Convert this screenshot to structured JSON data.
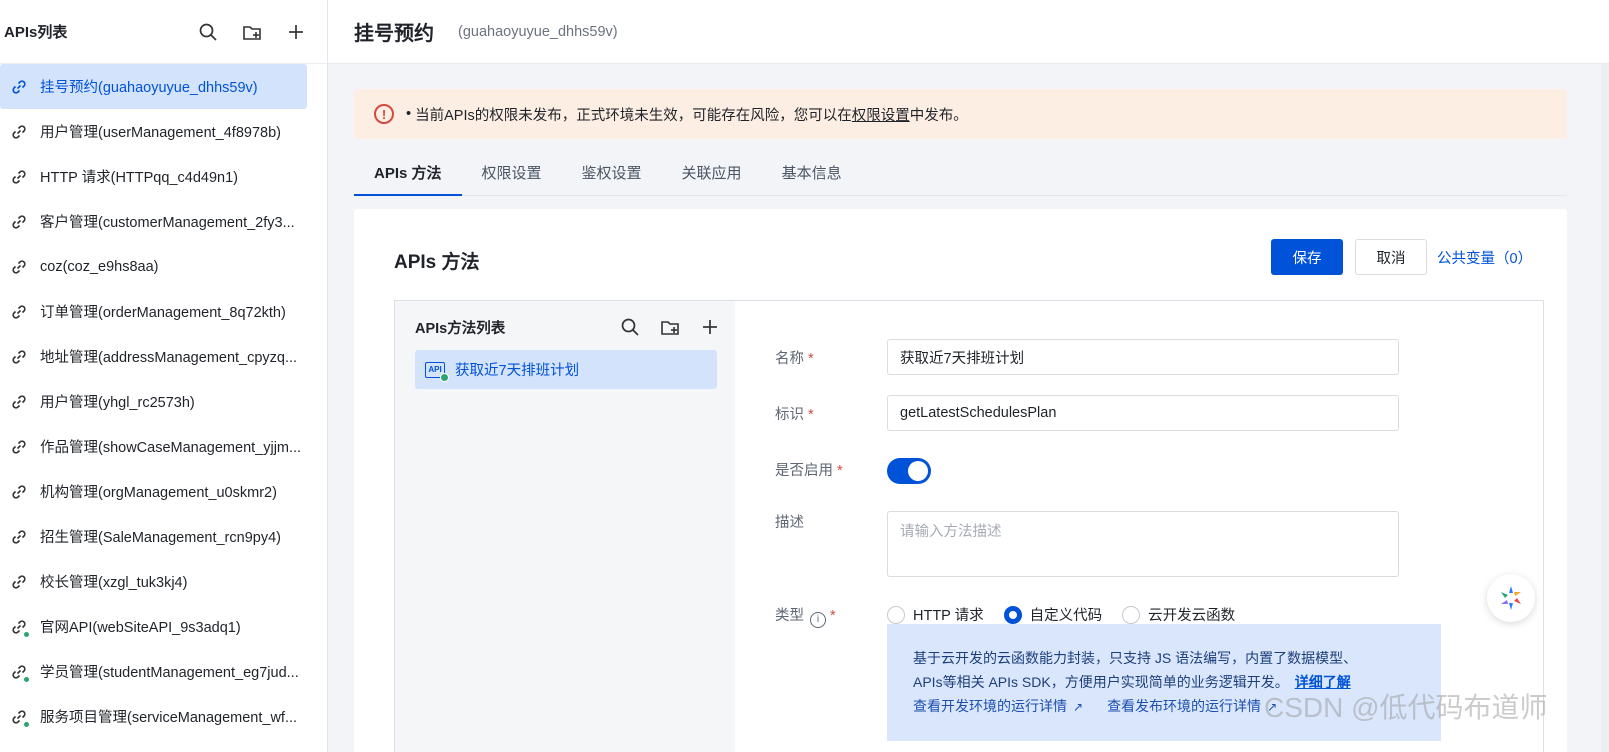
{
  "sidebar": {
    "title": "APIs列表",
    "items": [
      {
        "label": "挂号预约(guahaoyuyue_dhhs59v)",
        "icon": "link-icon"
      },
      {
        "label": "用户管理(userManagement_4f8978b)",
        "icon": "link-icon"
      },
      {
        "label": "HTTP 请求(HTTPqq_c4d49n1)",
        "icon": "link-icon"
      },
      {
        "label": "客户管理(customerManagement_2fy3...",
        "icon": "link-icon"
      },
      {
        "label": "coz(coz_e9hs8aa)",
        "icon": "link-icon"
      },
      {
        "label": "订单管理(orderManagement_8q72kth)",
        "icon": "link-icon"
      },
      {
        "label": "地址管理(addressManagement_cpyzq...",
        "icon": "link-icon"
      },
      {
        "label": "用户管理(yhgl_rc2573h)",
        "icon": "link-icon"
      },
      {
        "label": "作品管理(showCaseManagement_yjjm...",
        "icon": "link-icon"
      },
      {
        "label": "机构管理(orgManagement_u0skmr2)",
        "icon": "link-icon"
      },
      {
        "label": "招生管理(SaleManagement_rcn9py4)",
        "icon": "link-icon"
      },
      {
        "label": "校长管理(xzgl_tuk3kj4)",
        "icon": "link-icon"
      },
      {
        "label": "官网API(webSiteAPI_9s3adq1)",
        "icon": "link-published-icon"
      },
      {
        "label": "学员管理(studentManagement_eg7jud...",
        "icon": "link-published-icon"
      },
      {
        "label": "服务项目管理(serviceManagement_wf...",
        "icon": "link-published-icon"
      }
    ]
  },
  "header": {
    "title": "挂号预约",
    "subtitle": "(guahaoyuyue_dhhs59v)"
  },
  "alert": {
    "text_before": "当前APIs的权限未发布，正式环境未生效，可能存在风险，您可以在",
    "link": "权限设置",
    "text_after": "中发布。"
  },
  "tabs": [
    "APIs 方法",
    "权限设置",
    "鉴权设置",
    "关联应用",
    "基本信息"
  ],
  "panel": {
    "title": "APIs 方法",
    "save": "保存",
    "cancel": "取消",
    "public_vars": "公共变量（0）"
  },
  "method_list": {
    "title": "APIs方法列表",
    "items": [
      {
        "label": "获取近7天排班计划",
        "icon": "api-icon"
      }
    ]
  },
  "form": {
    "name_label": "名称",
    "name_value": "获取近7天排班计划",
    "id_label": "标识",
    "id_value": "getLatestSchedulesPlan",
    "enabled_label": "是否启用",
    "enabled": true,
    "desc_label": "描述",
    "desc_placeholder": "请输入方法描述",
    "type_label": "类型",
    "type_options": [
      "HTTP 请求",
      "自定义代码",
      "云开发云函数"
    ],
    "type_selected": "自定义代码"
  },
  "tip": {
    "line1": "基于云开发的云函数能力封装，只支持 JS 语法编写，内置了数据模型、",
    "line2": "APIs等相关 APIs SDK，方便用户实现简单的业务逻辑开发。",
    "more": "详细了解",
    "link_dev": "查看开发环境的运行详情",
    "link_prod": "查看发布环境的运行详情"
  },
  "watermark": "CSDN @低代码布道师",
  "colors": {
    "primary": "#0052d9",
    "alert_bg": "#fdeee3",
    "danger": "#d54941",
    "active_bg": "#d4e3fc"
  }
}
